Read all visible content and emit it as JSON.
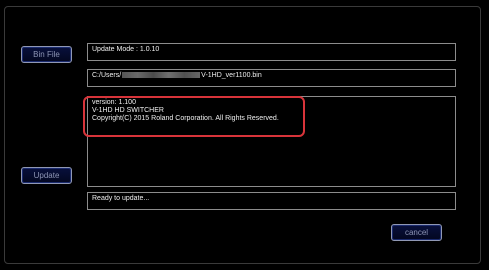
{
  "buttons": {
    "bin_file": "Bin File",
    "update": "Update",
    "cancel": "cancel"
  },
  "fields": {
    "update_mode": "Update Mode : 1.0.10",
    "path_prefix": "C:/Users/",
    "path_suffix": "V-1HD_ver1100.bin",
    "info_lines": [
      "version: 1.100",
      "V-1HD HD SWITCHER",
      "Copyright(C) 2015 Roland Corporation. All Rights Reserved."
    ],
    "status": "Ready to update..."
  },
  "colors": {
    "background": "#000000",
    "field_border": "#8c8c8c",
    "button_fill": "#08103c",
    "highlight": "#d8343a"
  }
}
